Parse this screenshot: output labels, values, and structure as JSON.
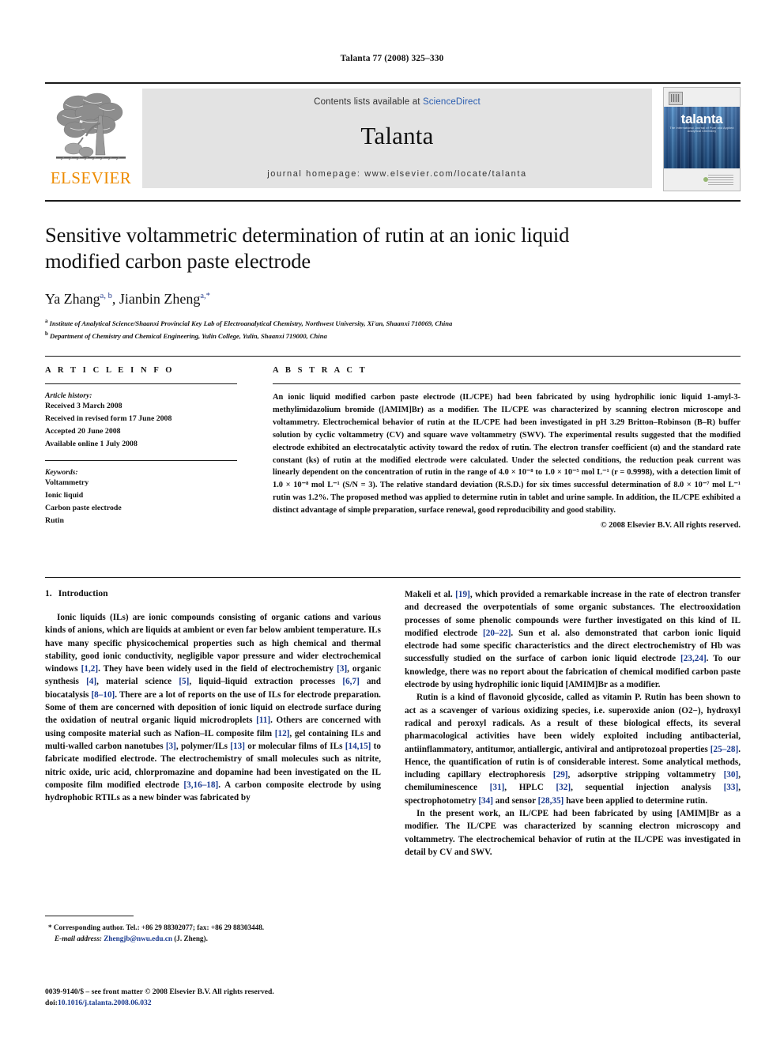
{
  "running_head": "Talanta 77 (2008) 325–330",
  "masthead": {
    "publisher": "ELSEVIER",
    "contents_prefix": "Contents lists available at ",
    "sciencedirect": "ScienceDirect",
    "journal_title": "Talanta",
    "homepage": "journal homepage: www.elsevier.com/locate/talanta",
    "cover_title": "talanta",
    "cover_subtitle": "The International Journal of Pure and Applied Analytical Chemistry",
    "link_color": "#2a5db0",
    "brand_orange": "#ED8B00"
  },
  "article": {
    "title": "Sensitive voltammetric determination of rutin at an ionic liquid modified carbon paste electrode",
    "authors_plain": "Ya Zhang",
    "author1_sup": "a, b",
    "author2_plain": ", Jianbin Zheng",
    "author2_sup": "a,*",
    "affiliation_a_sup": "a",
    "affiliation_a": " Institute of Analytical Science/Shaanxi Provincial Key Lab of Electroanalytical Chemistry, Northwest University, Xi'an, Shaanxi 710069, China",
    "affiliation_b_sup": "b",
    "affiliation_b": " Department of Chemistry and Chemical Engineering, Yulin College, Yulin, Shaanxi 719000, China"
  },
  "article_info": {
    "heading": "A R T I C L E   I N F O",
    "history_label": "Article history:",
    "history": [
      "Received 3 March 2008",
      "Received in revised form 17 June 2008",
      "Accepted 20 June 2008",
      "Available online 1 July 2008"
    ],
    "keywords_label": "Keywords:",
    "keywords": [
      "Voltammetry",
      "Ionic liquid",
      "Carbon paste electrode",
      "Rutin"
    ]
  },
  "abstract": {
    "heading": "A B S T R A C T",
    "text": "An ionic liquid modified carbon paste electrode (IL/CPE) had been fabricated by using hydrophilic ionic liquid 1-amyl-3-methylimidazolium bromide ([AMIM]Br) as a modifier. The IL/CPE was characterized by scanning electron microscope and voltammetry. Electrochemical behavior of rutin at the IL/CPE had been investigated in pH 3.29 Britton–Robinson (B–R) buffer solution by cyclic voltammetry (CV) and square wave voltammetry (SWV). The experimental results suggested that the modified electrode exhibited an electrocatalytic activity toward the redox of rutin. The electron transfer coefficient (α) and the standard rate constant (ks) of rutin at the modified electrode were calculated. Under the selected conditions, the reduction peak current was linearly dependent on the concentration of rutin in the range of 4.0 × 10⁻⁸ to 1.0 × 10⁻⁵ mol L⁻¹ (r = 0.9998), with a detection limit of 1.0 × 10⁻⁸ mol L⁻¹ (S/N = 3). The relative standard deviation (R.S.D.) for six times successful determination of 8.0 × 10⁻⁷ mol L⁻¹ rutin was 1.2%. The proposed method was applied to determine rutin in tablet and urine sample. In addition, the IL/CPE exhibited a distinct advantage of simple preparation, surface renewal, good reproducibility and good stability.",
    "copyright": "© 2008 Elsevier B.V. All rights reserved."
  },
  "body": {
    "section_number": "1.",
    "section_title": "Introduction",
    "left_paragraphs": [
      "Ionic liquids (ILs) are ionic compounds consisting of organic cations and various kinds of anions, which are liquids at ambient or even far below ambient temperature. ILs have many specific physicochemical properties such as high chemical and thermal stability, good ionic conductivity, negligible vapor pressure and wider electrochemical windows [1,2]. They have been widely used in the field of electrochemistry [3], organic synthesis [4], material science [5], liquid–liquid extraction processes [6,7] and biocatalysis [8–10]. There are a lot of reports on the use of ILs for electrode preparation. Some of them are concerned with deposition of ionic liquid on electrode surface during the oxidation of neutral organic liquid microdroplets [11]. Others are concerned with using composite material such as Nafion–IL composite film [12], gel containing ILs and multi-walled carbon nanotubes [3], polymer/ILs [13] or molecular films of ILs [14,15] to fabricate modified electrode. The electrochemistry of small molecules such as nitrite, nitric oxide, uric acid, chlorpromazine and dopamine had been investigated on the IL composite film modified electrode [3,16–18]. A carbon composite electrode by using hydrophobic RTILs as a new binder was fabricated by"
    ],
    "right_paragraphs": [
      "Makeli et al. [19], which provided a remarkable increase in the rate of electron transfer and decreased the overpotentials of some organic substances. The electrooxidation processes of some phenolic compounds were further investigated on this kind of IL modified electrode [20–22]. Sun et al. also demonstrated that carbon ionic liquid electrode had some specific characteristics and the direct electrochemistry of Hb was successfully studied on the surface of carbon ionic liquid electrode [23,24]. To our knowledge, there was no report about the fabrication of chemical modified carbon paste electrode by using hydrophilic ionic liquid [AMIM]Br as a modifier.",
      "Rutin is a kind of flavonoid glycoside, called as vitamin P. Rutin has been shown to act as a scavenger of various oxidizing species, i.e. superoxide anion (O2−), hydroxyl radical and peroxyl radicals. As a result of these biological effects, its several pharmacological activities have been widely exploited including antibacterial, antiinflammatory, antitumor, antiallergic, antiviral and antiprotozoal properties [25–28]. Hence, the quantification of rutin is of considerable interest. Some analytical methods, including capillary electrophoresis [29], adsorptive stripping voltammetry [30], chemiluminescence [31], HPLC [32], sequential injection analysis [33], spectrophotometry [34] and sensor [28,35] have been applied to determine rutin.",
      "In the present work, an IL/CPE had been fabricated by using [AMIM]Br as a modifier. The IL/CPE was characterized by scanning electron microscopy and voltammetry. The electrochemical behavior of rutin at the IL/CPE was investigated in detail by CV and SWV."
    ]
  },
  "footnotes": {
    "corresponding": "* Corresponding author. Tel.: +86 29 88302077; fax: +86 29 88303448.",
    "email_label": "E-mail address:",
    "email": "Zhengjb@nwu.edu.cn",
    "email_suffix": " (J. Zheng)."
  },
  "footer": {
    "issn_line": "0039-9140/$ – see front matter © 2008 Elsevier B.V. All rights reserved.",
    "doi_label": "doi:",
    "doi": "10.1016/j.talanta.2008.06.032"
  }
}
